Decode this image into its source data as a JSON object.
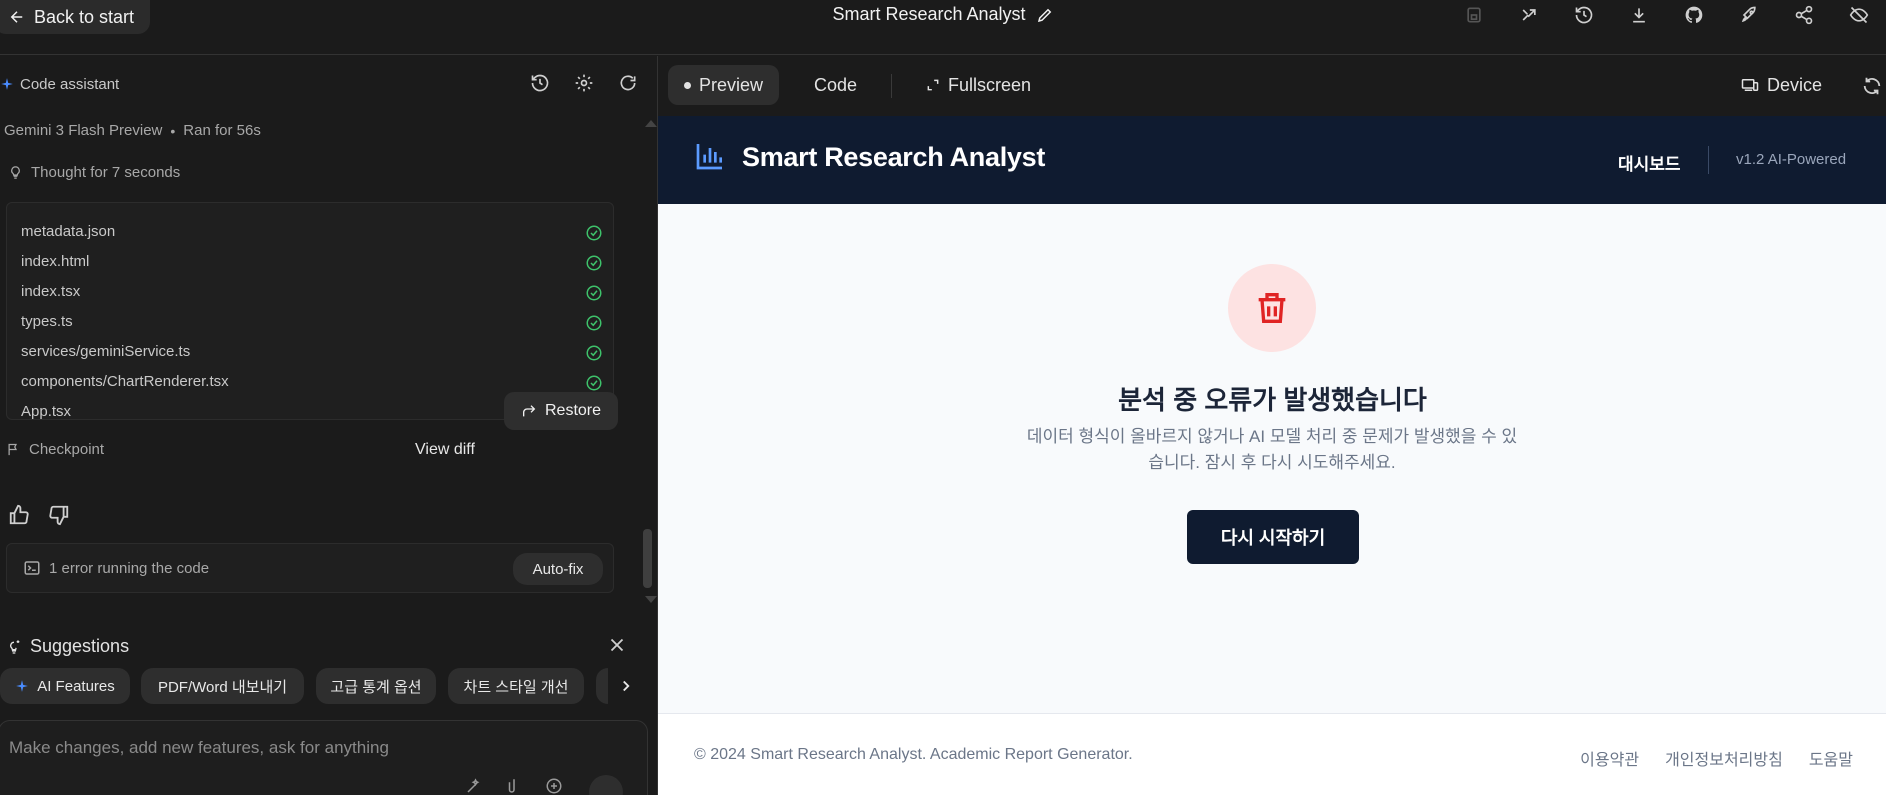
{
  "topbar": {
    "back_label": "Back to start",
    "title": "Smart Research Analyst",
    "icons": [
      "save-icon",
      "branch-icon",
      "history-icon",
      "download-icon",
      "github-icon",
      "rocket-icon",
      "share-icon",
      "visibility-off-icon"
    ]
  },
  "assistant": {
    "label": "Code assistant",
    "model": "Gemini 3 Flash Preview",
    "ran": "Ran for 56s",
    "thought": "Thought for 7 seconds",
    "files": [
      "metadata.json",
      "index.html",
      "index.tsx",
      "types.ts",
      "services/geminiService.ts",
      "components/ChartRenderer.tsx",
      "App.tsx"
    ],
    "checkpoint": "Checkpoint",
    "view_diff": "View diff",
    "restore": "Restore",
    "error_text": "1 error running the code",
    "autofix": "Auto-fix",
    "suggestions_title": "Suggestions",
    "chips": [
      "AI Features",
      "PDF/Word 내보내기",
      "고급 통계 옵션",
      "차트 스타일 개선"
    ],
    "prompt_placeholder": "Make changes, add new features, ask for anything"
  },
  "preview_tabs": {
    "preview": "Preview",
    "code": "Code",
    "fullscreen": "Fullscreen",
    "device": "Device"
  },
  "app": {
    "name": "Smart Research Analyst",
    "nav_dashboard": "대시보드",
    "version": "v1.2 AI-Powered",
    "error_title": "분석 중 오류가 발생했습니다",
    "error_desc": "데이터 형식이 올바르지 않거나 AI 모델 처리 중 문제가 발생했을 수 있습니다. 잠시 후 다시 시도해주세요.",
    "retry_label": "다시 시작하기",
    "footer_copy": "© 2024 Smart Research Analyst. Academic Report Generator.",
    "footer_links": [
      "이용약관",
      "개인정보처리방침",
      "도움말"
    ]
  },
  "colors": {
    "accent": "#4a8cff",
    "app_navy": "#0f1b30",
    "error_red": "#e02424",
    "success_green": "#3ec26b"
  }
}
